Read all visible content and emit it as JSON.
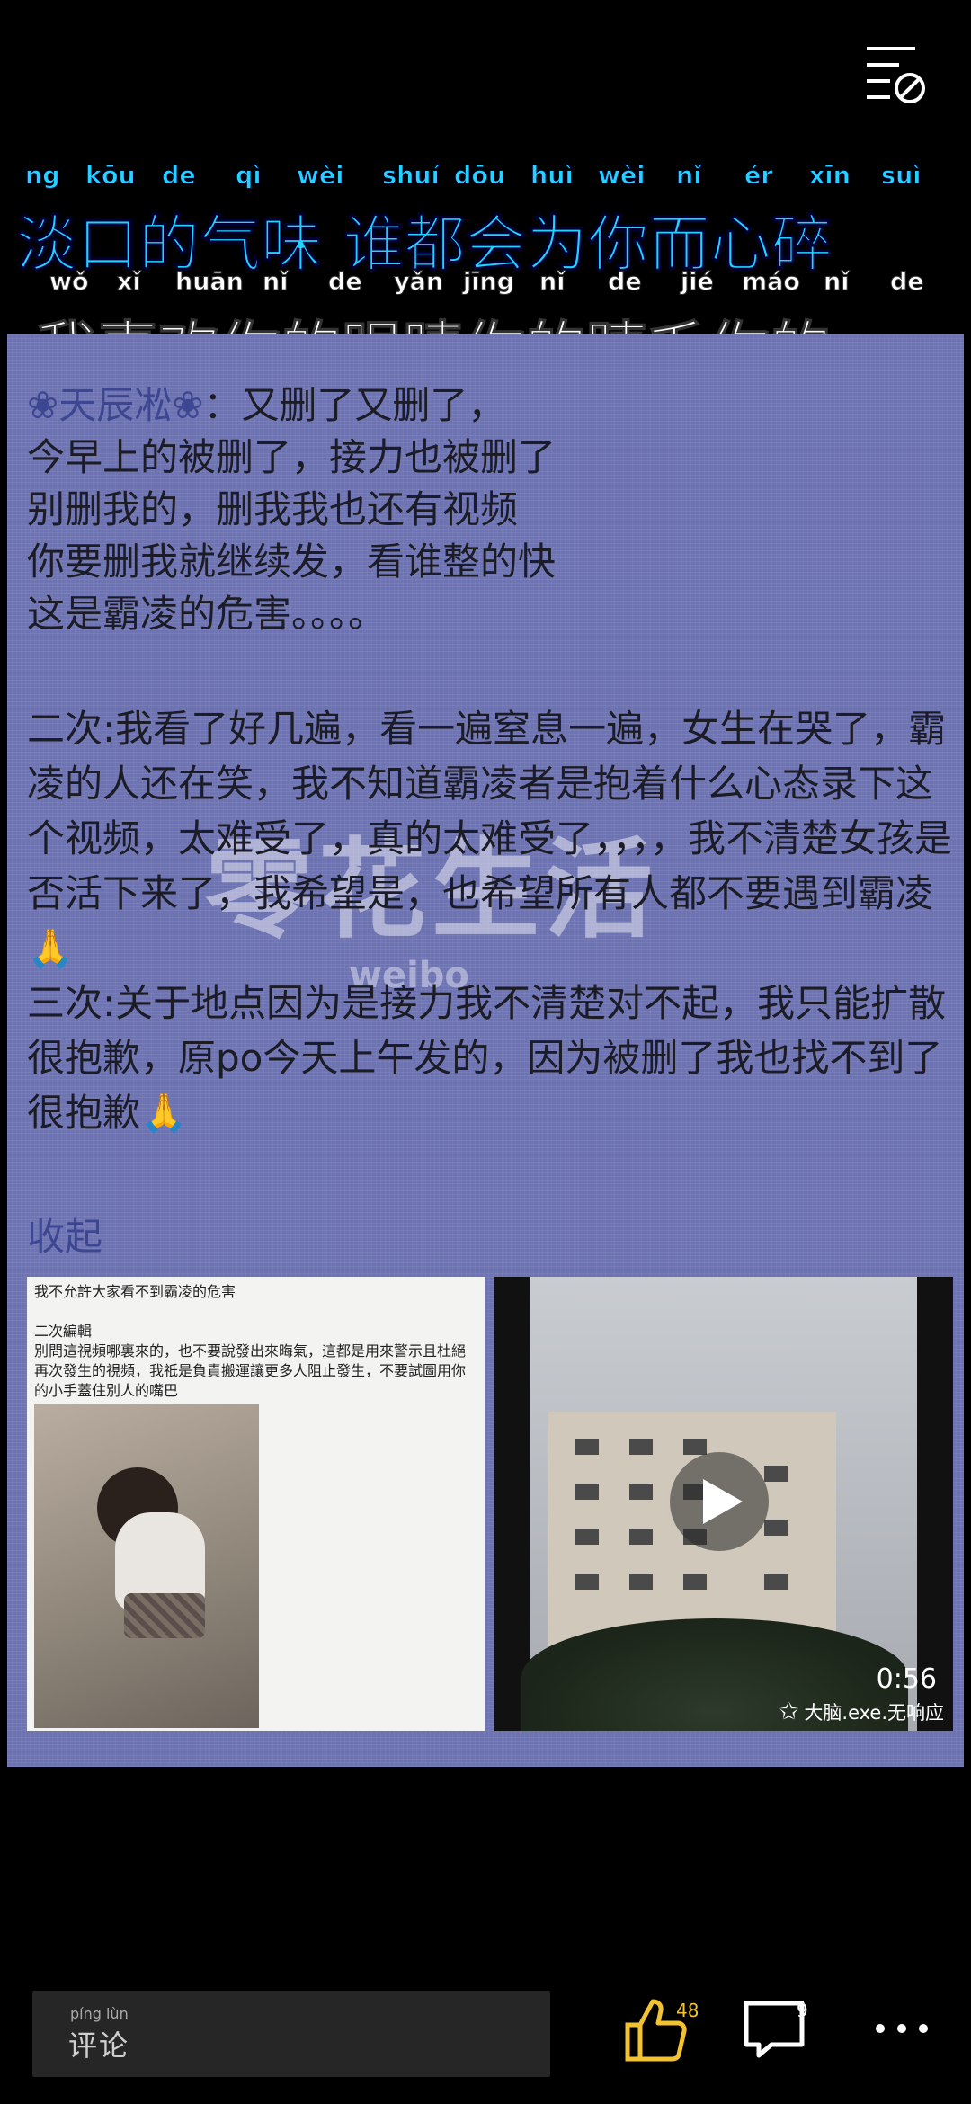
{
  "top": {
    "menu_icon": "list-hide-icon"
  },
  "lyrics": {
    "line1": {
      "hanzi": "淡口的气味 谁都会为你而心碎",
      "pinyin": [
        "ng",
        "kōu",
        "de",
        "qì",
        "wèi",
        "shuí",
        "dōu",
        "huì",
        "wèi",
        "nǐ",
        "ér",
        "xīn",
        "suì"
      ]
    },
    "line2": {
      "hanzi": "我喜欢你的眼睛你的睫毛你的",
      "pinyin": [
        "wǒ",
        "xǐ",
        "huān",
        "nǐ",
        "de",
        "yǎn",
        "jīng",
        "nǐ",
        "de",
        "jié",
        "máo",
        "nǐ",
        "de"
      ]
    }
  },
  "post": {
    "author": "❀天辰凇❀",
    "line1": "：又删了又删了，",
    "line2": "今早上的被删了，接力也被删了",
    "line3": "别删我的，删我我也还有视频",
    "line4": "你要删我就继续发，看谁整的快",
    "line5": "这是霸凌的危害。。。。",
    "para2": "二次:我看了好几遍，看一遍窒息一遍，女生在哭了，霸凌的人还在笑，我不知道霸凌者是抱着什么心态录下这个视频，太难受了，真的太难受了，，，，我不清楚女孩是否活下来了，我希望是，也希望所有人都不要遇到霸凌🙏",
    "para3": "三次:关于地点因为是接力我不清楚对不起，我只能扩散很抱歉，原po今天上午发的，因为被删了我也找不到了很抱歉🙏",
    "collapse": "收起",
    "watermark": "零花生活",
    "watermark_small": "weibo"
  },
  "thumb_left": {
    "caption": "我不允許大家看不到霸凌的危害\n\n二次編輯\n別問這視頻哪裏來的，也不要說發出來晦氣，這都是用來警示且杜絕再次發生的視頻，我祇是負責搬運讓更多人阻止發生，不要試圖用你的小手蓋住別人的嘴巴"
  },
  "thumb_right": {
    "duration": "0:56",
    "source": "大脑.exe.无响应"
  },
  "bottom": {
    "comment_placeholder": "评论",
    "comment_pinyin": "píng  lùn",
    "like_count": "48",
    "comment_count": "9"
  },
  "colors": {
    "accent": "#f2c230",
    "lyric1": "#22d3ff",
    "post_bg": "#6e74b3",
    "author": "#3d4690"
  }
}
